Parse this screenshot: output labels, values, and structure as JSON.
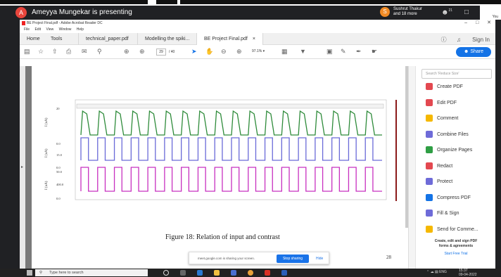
{
  "meet": {
    "avatar_letter": "A",
    "presenting": "Ameyya Mungekar is presenting",
    "viewer_avatar_letter": "S",
    "viewer_name": "Sushrut Thakur",
    "viewer_more": "and 18 more",
    "people_count": "21",
    "you_label": "You",
    "notice_text": "meet.google.com is sharing your screen.",
    "stop_label": "Stop sharing",
    "hide_label": "Hide"
  },
  "window": {
    "title": "BE Project Final.pdf - Adobe Acrobat Reader DC",
    "menu": [
      "File",
      "Edit",
      "View",
      "Window",
      "Help"
    ]
  },
  "tabs": [
    {
      "label": "Home"
    },
    {
      "label": "Tools"
    },
    {
      "label": "technical_paper.pdf"
    },
    {
      "label": "Modelling the spiki..."
    },
    {
      "label": "BE Project Final.pdf"
    }
  ],
  "tab_close": "×",
  "sign_in": "Sign In",
  "toolbar": {
    "page_current": "29",
    "page_total": "/ 40",
    "zoom": "97.1%",
    "share": "Share"
  },
  "search_placeholder": "Search 'Reduce Size'",
  "tools": [
    {
      "label": "Create PDF",
      "color": "#e34850"
    },
    {
      "label": "Edit PDF",
      "color": "#e34850"
    },
    {
      "label": "Comment",
      "color": "#f5b800"
    },
    {
      "label": "Combine Files",
      "color": "#6e6bd8"
    },
    {
      "label": "Organize Pages",
      "color": "#2f9e44"
    },
    {
      "label": "Redact",
      "color": "#e34850"
    },
    {
      "label": "Protect",
      "color": "#6e6bd8"
    },
    {
      "label": "Compress PDF",
      "color": "#1473e6"
    },
    {
      "label": "Fill & Sign",
      "color": "#6e6bd8"
    },
    {
      "label": "Send for Comme...",
      "color": "#f5b800"
    }
  ],
  "promo": {
    "line1": "Create, edit and sign PDF",
    "line2": "forms & agreements",
    "trial": "Start Free Trial"
  },
  "figure": {
    "caption": "Figure 18: Relation of input and contrast",
    "page_number": "28",
    "axis_labels": [
      "I (uA)",
      "I (uA)",
      "I (uA)"
    ],
    "tick_labels": [
      "20",
      "0.0",
      "15.0",
      "0.0",
      "50.0",
      "400.0",
      "0.0"
    ],
    "trace_colors": [
      "#2e8b3a",
      "#6a6ad8",
      "#c830c0"
    ]
  },
  "taskbar": {
    "search_placeholder": "Type here to search",
    "lang": "ENG",
    "time": "15:37",
    "date": "09-04-2022"
  }
}
